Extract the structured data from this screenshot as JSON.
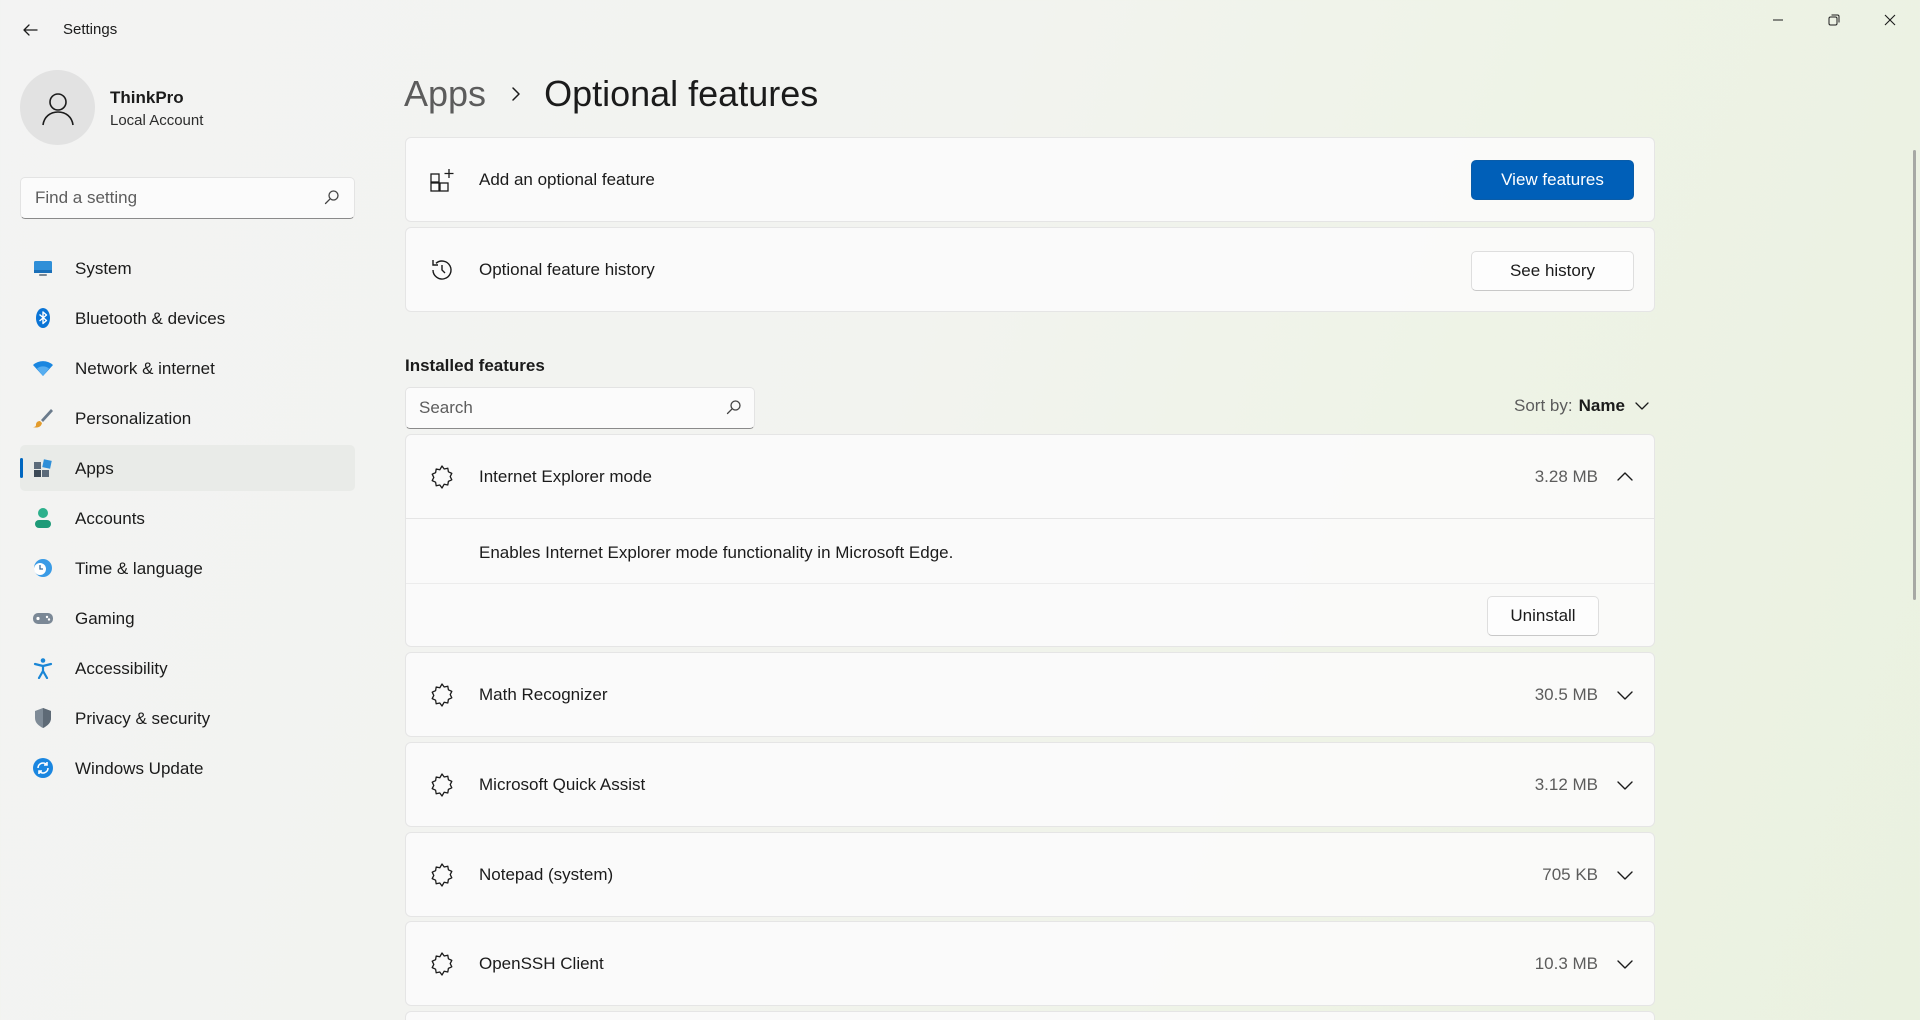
{
  "window": {
    "title": "Settings"
  },
  "profile": {
    "name": "ThinkPro",
    "account_type": "Local Account"
  },
  "sidebar": {
    "search_placeholder": "Find a setting",
    "items": [
      {
        "label": "System",
        "icon": "system-icon",
        "active": false
      },
      {
        "label": "Bluetooth & devices",
        "icon": "bluetooth-icon",
        "active": false
      },
      {
        "label": "Network & internet",
        "icon": "wifi-icon",
        "active": false
      },
      {
        "label": "Personalization",
        "icon": "brush-icon",
        "active": false
      },
      {
        "label": "Apps",
        "icon": "apps-icon",
        "active": true
      },
      {
        "label": "Accounts",
        "icon": "person-icon",
        "active": false
      },
      {
        "label": "Time & language",
        "icon": "clock-globe-icon",
        "active": false
      },
      {
        "label": "Gaming",
        "icon": "gamepad-icon",
        "active": false
      },
      {
        "label": "Accessibility",
        "icon": "accessibility-icon",
        "active": false
      },
      {
        "label": "Privacy & security",
        "icon": "shield-icon",
        "active": false
      },
      {
        "label": "Windows Update",
        "icon": "update-icon",
        "active": false
      }
    ]
  },
  "breadcrumb": {
    "parent": "Apps",
    "current": "Optional features"
  },
  "add_feature": {
    "label": "Add an optional feature",
    "button": "View features"
  },
  "history": {
    "label": "Optional feature history",
    "button": "See history"
  },
  "installed": {
    "title": "Installed features",
    "search_placeholder": "Search",
    "sort_label": "Sort by:",
    "sort_value": "Name",
    "features": [
      {
        "name": "Internet Explorer mode",
        "size": "3.28 MB",
        "expanded": true,
        "description": "Enables Internet Explorer mode functionality in Microsoft Edge.",
        "action": "Uninstall"
      },
      {
        "name": "Math Recognizer",
        "size": "30.5 MB",
        "expanded": false
      },
      {
        "name": "Microsoft Quick Assist",
        "size": "3.12 MB",
        "expanded": false
      },
      {
        "name": "Notepad (system)",
        "size": "705 KB",
        "expanded": false
      },
      {
        "name": "OpenSSH Client",
        "size": "10.3 MB",
        "expanded": false
      }
    ]
  },
  "colors": {
    "accent": "#005fb8",
    "selected_nav": "#e9ebe8"
  }
}
